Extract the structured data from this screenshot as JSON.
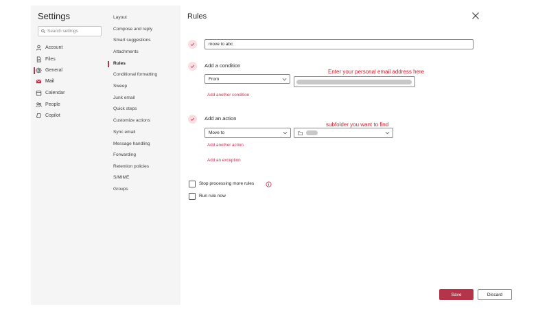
{
  "settings": {
    "title": "Settings",
    "search_placeholder": "Search settings",
    "categories": [
      {
        "label": "Account",
        "icon": "person-icon"
      },
      {
        "label": "Files",
        "icon": "file-icon"
      },
      {
        "label": "General",
        "icon": "gear-icon"
      },
      {
        "label": "Mail",
        "icon": "mail-icon"
      },
      {
        "label": "Calendar",
        "icon": "calendar-icon"
      },
      {
        "label": "People",
        "icon": "people-icon"
      },
      {
        "label": "Copilot",
        "icon": "copilot-icon"
      }
    ],
    "active_category": "Mail",
    "subitems": [
      "Layout",
      "Compose and reply",
      "Smart suggestions",
      "Attachments",
      "Rules",
      "Conditional formatting",
      "Sweep",
      "Junk email",
      "Quick steps",
      "Customize actions",
      "Sync email",
      "Message handling",
      "Forwarding",
      "Retention policies",
      "S/MIME",
      "Groups"
    ],
    "active_subitem": "Rules"
  },
  "rules": {
    "title": "Rules",
    "rule_name": "move to abc",
    "condition": {
      "heading": "Add a condition",
      "field": "From",
      "annotation": "Enter your personal email address here",
      "add_link": "Add another condition"
    },
    "action": {
      "heading": "Add an action",
      "field": "Move to",
      "annotation": "subfolder you want to find",
      "add_link": "Add another action"
    },
    "exception_link": "Add an exception",
    "stop_processing_label": "Stop processing more rules",
    "run_now_label": "Run rule now",
    "save_label": "Save",
    "discard_label": "Discard"
  },
  "colors": {
    "accent": "#b4344a",
    "annotation": "#d11a2a",
    "link": "#c4314b",
    "sidebar_bg": "#f5f5f5"
  }
}
